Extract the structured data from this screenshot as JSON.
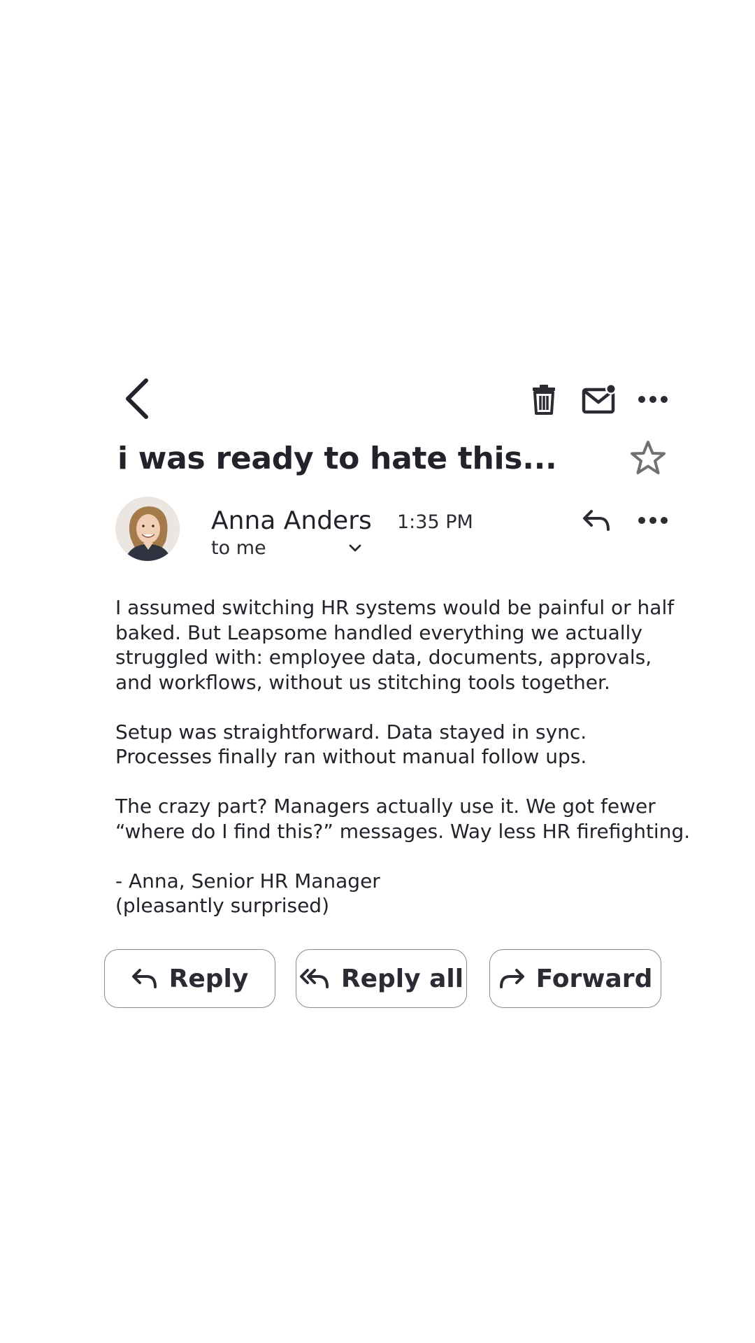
{
  "toolbar": {
    "back_icon": "chevron-left-icon",
    "delete_icon": "trash-icon",
    "mark_unread_icon": "mail-unread-icon",
    "more_icon": "more-horizontal-icon"
  },
  "email": {
    "subject": "i was ready to hate this...",
    "starred": false,
    "sender": {
      "name": "Anna Anders",
      "recipient_label": "to me",
      "time": "1:35 PM"
    },
    "body": {
      "p1": [
        "I assumed switching HR systems would be painful or half",
        "baked. But Leapsome handled everything we actually",
        "struggled with: employee data, documents, approvals,",
        "and workflows, without us stitching tools together."
      ],
      "p2": [
        "Setup was straightforward. Data stayed in sync.",
        "Processes finally ran without manual follow ups."
      ],
      "p3": [
        "The crazy part? Managers actually use it. We got fewer",
        "“where do I find this?” messages. Way less HR firefighting."
      ],
      "p4": [
        "- Anna, Senior HR Manager",
        "(pleasantly surprised)"
      ]
    }
  },
  "actions": {
    "reply": "Reply",
    "reply_all": "Reply all",
    "forward": "Forward"
  },
  "colors": {
    "text": "#22222b",
    "border": "#8a8a90",
    "star": "#707070"
  }
}
